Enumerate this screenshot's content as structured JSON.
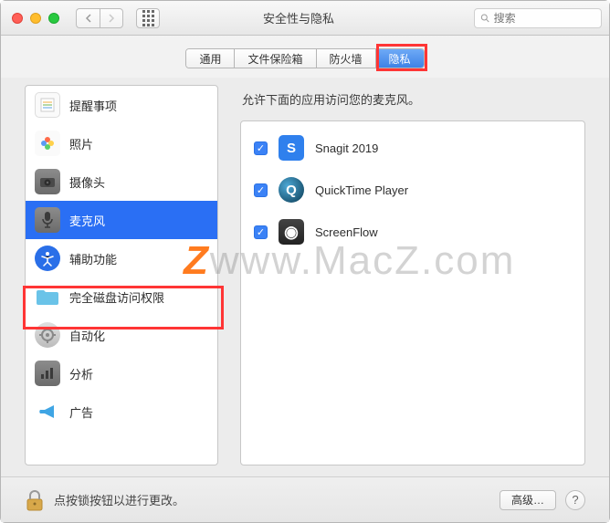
{
  "window": {
    "title": "安全性与隐私",
    "search_placeholder": "搜索"
  },
  "tabs": [
    {
      "label": "通用"
    },
    {
      "label": "文件保险箱"
    },
    {
      "label": "防火墙"
    },
    {
      "label": "隐私",
      "active": true
    }
  ],
  "sidebar": {
    "items": [
      {
        "label": "提醒事项",
        "icon": "reminders"
      },
      {
        "label": "照片",
        "icon": "photos"
      },
      {
        "label": "摄像头",
        "icon": "camera"
      },
      {
        "label": "麦克风",
        "icon": "microphone",
        "selected": true
      },
      {
        "label": "辅助功能",
        "icon": "accessibility"
      },
      {
        "label": "完全磁盘访问权限",
        "icon": "disk"
      },
      {
        "label": "自动化",
        "icon": "automation"
      },
      {
        "label": "分析",
        "icon": "analytics"
      },
      {
        "label": "广告",
        "icon": "ads"
      }
    ]
  },
  "main": {
    "description": "允许下面的应用访问您的麦克风。",
    "apps": [
      {
        "name": "Snagit 2019",
        "checked": true,
        "color": "#2f80ed",
        "glyph": "S"
      },
      {
        "name": "QuickTime Player",
        "checked": true,
        "color": "#1f4d6b",
        "glyph": "Q"
      },
      {
        "name": "ScreenFlow",
        "checked": true,
        "color": "#2a2a2a",
        "glyph": "●"
      }
    ]
  },
  "footer": {
    "lock_text": "点按锁按钮以进行更改。",
    "advanced": "高级…",
    "help": "?"
  },
  "watermark": {
    "prefix": "",
    "z": "Z",
    "rest": "www.MacZ.com"
  }
}
